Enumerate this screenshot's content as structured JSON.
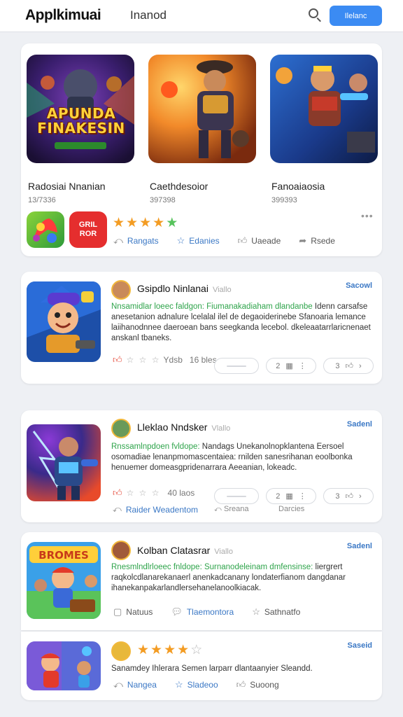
{
  "header": {
    "brand": "Applkimuai",
    "title": "Inanod",
    "cta_label": "Ilelanc"
  },
  "featured": {
    "items": [
      {
        "name": "Radosiai Nnanian",
        "meta": "13/7336",
        "logo_text": "APUNDA FINAKESIN"
      },
      {
        "name": "Caethdesoior",
        "meta": "397398",
        "logo_text": ""
      },
      {
        "name": "Fanoaiaosia",
        "meta": "399393",
        "logo_text": ""
      }
    ],
    "mini_icon_text": "GRIL\nROR",
    "rating": 4.5,
    "actions": [
      {
        "icon": "reply-icon",
        "label": "Rangats"
      },
      {
        "icon": "star-outline-icon",
        "label": "Edanies"
      },
      {
        "icon": "thumb-up-icon",
        "label": "Uaeade"
      },
      {
        "icon": "share-icon",
        "label": "Rsede"
      }
    ],
    "more_label": "•••"
  },
  "list": [
    {
      "title": "Gsipdlo Ninlanai",
      "sub": "Viallo",
      "tag": "Sacowl",
      "desc_hl": "Nnsamidlar loeec faldgon: Fiumanakadiaham dlandanbe",
      "desc": " Idenn carsafse anesetanion adnalure lcelalal ilel de degaoiderinebe Sfanoaria lemance laiihanodnnee daeroean bans seegkanda lecebol. dkeleaatarrlaricnenaet anskanl tbaneks.",
      "count_label": "Ydsb",
      "count": "16 bles",
      "pills": [
        "",
        "2",
        "3"
      ],
      "captions": [
        "",
        "",
        ""
      ]
    },
    {
      "title": "Lleklao Nndsker",
      "sub": "Vlallo",
      "tag": "Sadenl",
      "desc_hl": "Rnssamlnpdoen fvldope: ",
      "desc": "Nandags Unekanolnopklantena Eersoel osomadiae lenanpmomascentaiea: rnilden sanesrihanan eoolbonka henuemer domeasgpridenarrara Aeeanian, lokeadc.",
      "count_label": "",
      "count": "40 laos",
      "pills": [
        "",
        "2",
        "3"
      ],
      "captions": [
        "Raider Weadentom",
        "Sreana",
        "Darcies"
      ]
    },
    {
      "title": "Kolban Clatasrar",
      "sub": "Viallo",
      "tag": "Sadenl",
      "desc_hl": "Rnesmlndlrloeec fnldope: Surnanodeleinam dmfensinse:",
      "desc": " liergrert raqkolcdlanarekanaerl anenkadcanany londaterfianom dangdanar ihanekanpakarlandlersehanelanoolkiacak.",
      "actions": [
        "Natuus",
        "Tlaemontora",
        "Sathnatfo"
      ]
    },
    {
      "tag": "Saseid",
      "desc": "Sanamdey Ihlerara Semen larparr dlantaanyier Sleandd.",
      "actions": [
        "Nangea",
        "Sladeoo",
        "Suoong"
      ],
      "rating": 3.5
    }
  ],
  "colors": {
    "accent": "#3b8bf3",
    "link": "#3b78c5",
    "highlight_text": "#2fa44b",
    "star": "#f39c23",
    "star_green": "#57c35c"
  }
}
